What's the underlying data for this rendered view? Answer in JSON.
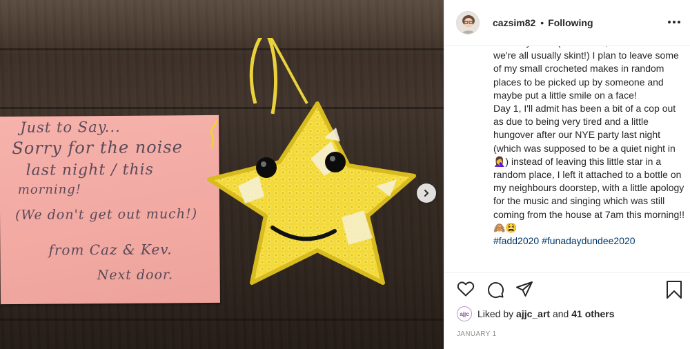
{
  "post": {
    "username": "cazsim82",
    "separator": "•",
    "follow_status": "Following",
    "more_icon": "more-horizontal-icon",
    "photo_note_lines": [
      "Just to Say...",
      "Sorry for the noise",
      "last night / this",
      "morning!",
      "(We don't get out much!)",
      "from Caz & Kev.",
      "Next door."
    ],
    "caption_paragraphs": [
      "for many of us (as it's cold, it's dark and we're all usually skint!) I plan to leave some of my small crocheted makes in random places to be picked up by someone and maybe put a little smile on a face!",
      "Day 1, I'll admit has been a bit of a cop out as due to being very tired and a little hungover after our NYE party last night (which was supposed to be a quiet night in 🤦‍♀️) instead of leaving this little star in a random place, I left it attached to a bottle on my neighbours doorstep, with a little apology for the music and singing which was still coming from the house at 7am this morning!! 🙈😫"
    ],
    "hashtags": [
      "#fadd2020",
      "#funadaydundee2020"
    ],
    "likes": {
      "prefix": "Liked by",
      "user": "ajjc_art",
      "middle": "and",
      "others": "41 others",
      "mini_avatar_text": "ajjc"
    },
    "date": "JANUARY 1"
  },
  "colors": {
    "text": "#262626",
    "hashtag": "#00376b",
    "muted": "#8e8e8e",
    "note": "#f2aaa3",
    "star": "#f5dc3a"
  }
}
